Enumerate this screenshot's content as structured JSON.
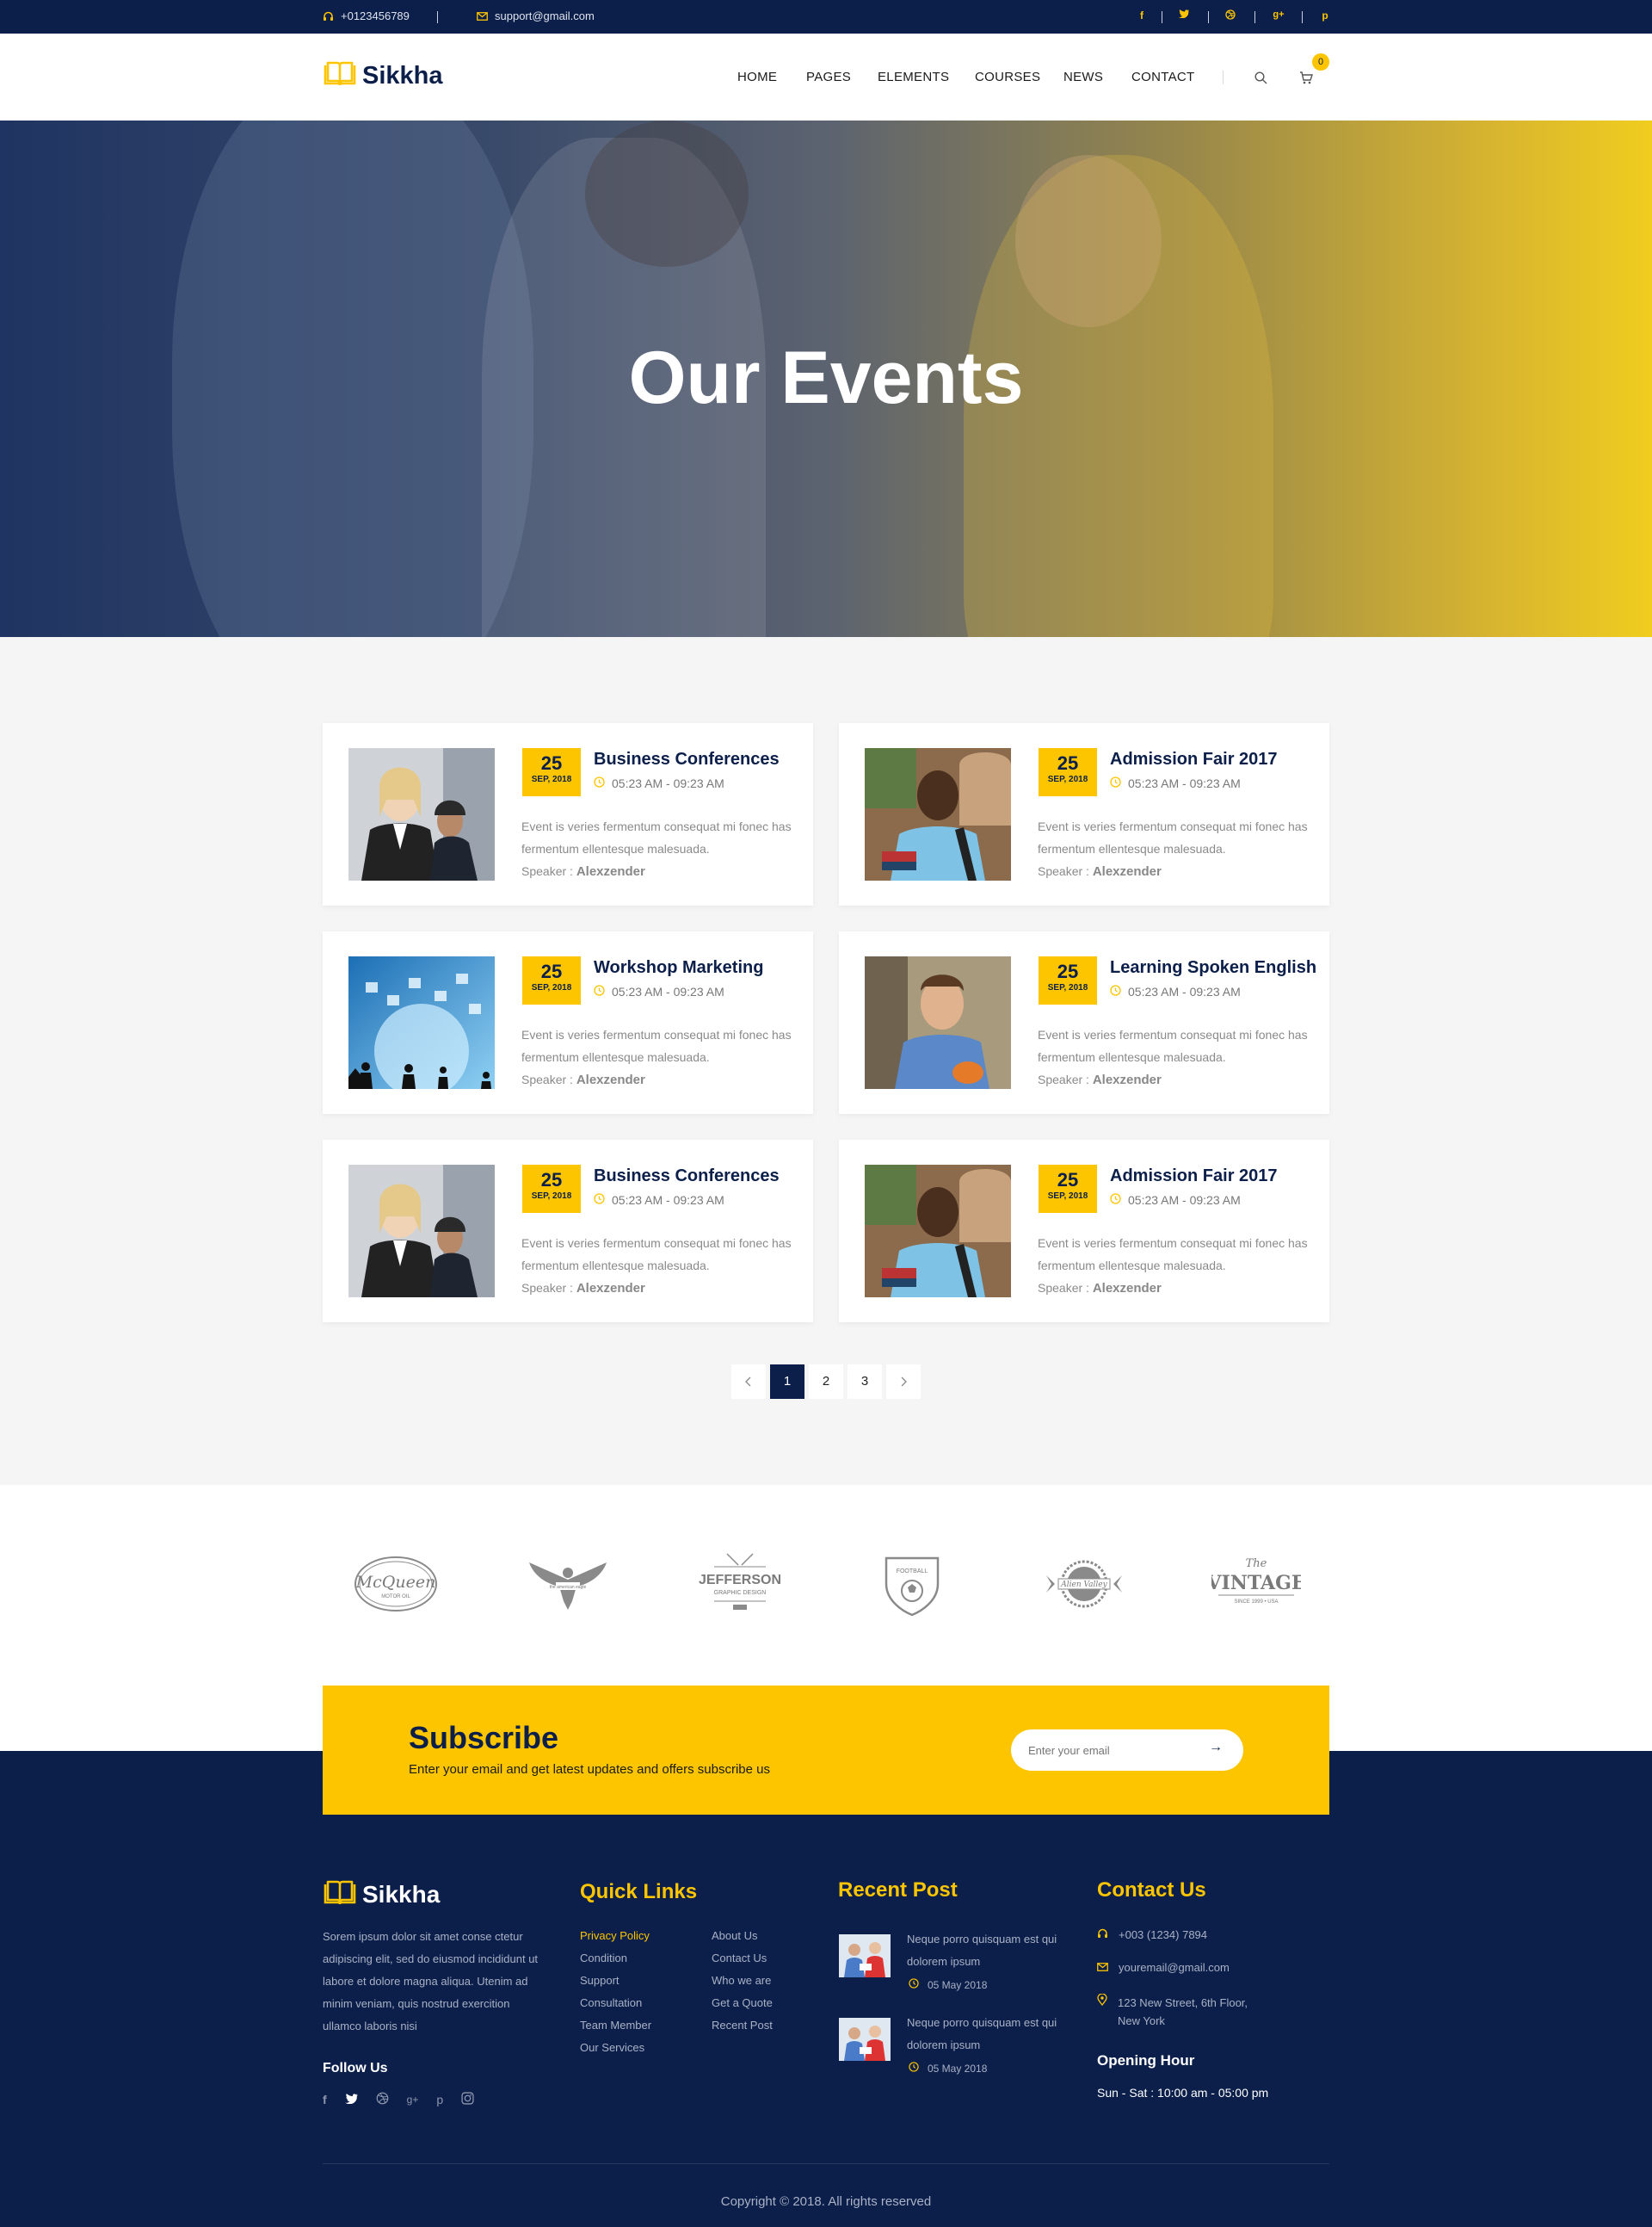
{
  "topbar": {
    "phone": "+0123456789",
    "email": "support@gmail.com",
    "socials": [
      "facebook-icon",
      "twitter-icon",
      "dribbble-icon",
      "google-plus-icon",
      "pinterest-icon"
    ]
  },
  "header": {
    "logo": "Sikkha",
    "nav": [
      "HOME",
      "PAGES",
      "ELEMENTS",
      "COURSES",
      "NEWS",
      "CONTACT"
    ],
    "cart_count": "0"
  },
  "hero": {
    "title": "Our Events"
  },
  "events": [
    {
      "day": "25",
      "month": "SEP, 2018",
      "title": "Business Conferences",
      "time": "05:23 AM - 09:23 AM",
      "desc": "Event is veries fermentum consequat mi fonec has fermentum ellentesque malesuada.",
      "speaker_label": "Speaker :",
      "speaker": "Alexzender"
    },
    {
      "day": "25",
      "month": "SEP, 2018",
      "title": "Admission Fair 2017",
      "time": "05:23 AM - 09:23 AM",
      "desc": "Event is veries fermentum consequat mi fonec has fermentum ellentesque malesuada.",
      "speaker_label": "Speaker :",
      "speaker": "Alexzender"
    },
    {
      "day": "25",
      "month": "SEP, 2018",
      "title": "Workshop Marketing",
      "time": "05:23 AM - 09:23 AM",
      "desc": "Event is veries fermentum consequat mi fonec has fermentum ellentesque malesuada.",
      "speaker_label": "Speaker :",
      "speaker": "Alexzender"
    },
    {
      "day": "25",
      "month": "SEP, 2018",
      "title": "Learning Spoken English",
      "time": "05:23 AM - 09:23 AM",
      "desc": "Event is veries fermentum consequat mi fonec has fermentum ellentesque malesuada.",
      "speaker_label": "Speaker :",
      "speaker": "Alexzender"
    },
    {
      "day": "25",
      "month": "SEP, 2018",
      "title": "Business Conferences",
      "time": "05:23 AM - 09:23 AM",
      "desc": "Event is veries fermentum consequat mi fonec has fermentum ellentesque malesuada.",
      "speaker_label": "Speaker :",
      "speaker": "Alexzender"
    },
    {
      "day": "25",
      "month": "SEP, 2018",
      "title": "Admission Fair 2017",
      "time": "05:23 AM - 09:23 AM",
      "desc": "Event is veries fermentum consequat mi fonec has fermentum ellentesque malesuada.",
      "speaker_label": "Speaker :",
      "speaker": "Alexzender"
    }
  ],
  "pagination": {
    "pages": [
      "1",
      "2",
      "3"
    ],
    "active": "1"
  },
  "brands": {
    "mcqueen": "McQueen",
    "mcqueen_sub": "MOTOR OIL",
    "eagle": "the american eagle",
    "jefferson": "JEFFERSON",
    "jefferson_sub": "GRAPHIC DESIGN",
    "football": "FOOTBALL",
    "alien": "Alien Valley",
    "vintage_the": "The",
    "vintage": "VINTAGE",
    "vintage_sub": "SINCE 1999 • USA"
  },
  "subscribe": {
    "title": "Subscribe",
    "text": "Enter  your email and get latest updates and offers subscribe us",
    "placeholder": "Enter your email",
    "button": "→"
  },
  "footer": {
    "logo": "Sikkha",
    "about": "Sorem ipsum dolor sit amet conse ctetur adipiscing elit, sed do eiusmod  incididunt ut labore et dolore magna aliqua. Utenim ad minim veniam, quis nostrud exercition ullamco laboris nisi",
    "follow_us": "Follow Us",
    "quick_links_title": "Quick Links",
    "quick_links_col1": [
      "Privacy Policy",
      "Condition",
      "Support",
      "Consultation",
      "Team Member",
      "Our Services"
    ],
    "quick_links_col2": [
      "About Us",
      "Contact Us",
      "Who we are",
      "Get a Quote",
      "Recent Post"
    ],
    "recent_title": "Recent Post",
    "recent_posts": [
      {
        "title": "Neque porro quisquam est qui dolorem ipsum",
        "date": "05 May 2018"
      },
      {
        "title": "Neque porro quisquam est qui dolorem ipsum",
        "date": "05 May 2018"
      }
    ],
    "contact_title": "Contact Us",
    "contact": {
      "phone": "+003 (1234) 7894",
      "email": "youremail@gmail.com",
      "address_line1": "123 New Street, 6th Floor,",
      "address_line2": "New York"
    },
    "opening_title": "Opening Hour",
    "opening_hours": "Sun - Sat : 10:00 am - 05:00 pm",
    "copyright": "Copyright © 2018. All rights reserved"
  },
  "colors": {
    "navy": "#0c1f4a",
    "yellow": "#fcc500"
  }
}
